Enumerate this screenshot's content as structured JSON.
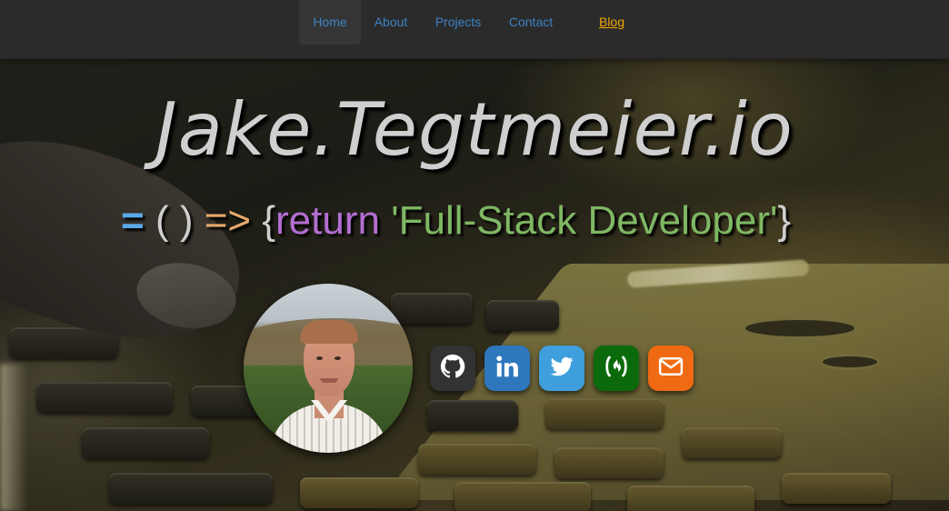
{
  "nav": {
    "items": [
      {
        "label": "Home",
        "active": true
      },
      {
        "label": "About",
        "active": false
      },
      {
        "label": "Projects",
        "active": false
      },
      {
        "label": "Contact",
        "active": false
      }
    ],
    "blog_label": "Blog",
    "colors": {
      "link": "#3d82c4",
      "blog": "#f0a500",
      "background": "#2b2b2b"
    }
  },
  "hero": {
    "title": "Jake.Tegtmeier.io",
    "tagline": {
      "equals": "=",
      "parens": "( )",
      "arrow": "=>",
      "open_brace": "{",
      "keyword": "return",
      "string": "'Full-Stack Developer'",
      "close_brace": "}"
    },
    "avatar_icon": "profile-photo"
  },
  "social": [
    {
      "name": "github",
      "icon": "github-icon",
      "color": "#333333"
    },
    {
      "name": "linkedin",
      "icon": "linkedin-icon",
      "color": "#2e77bd"
    },
    {
      "name": "twitter",
      "icon": "twitter-icon",
      "color": "#3f9fdc"
    },
    {
      "name": "freecodecamp",
      "icon": "freecodecamp-icon",
      "color": "#0b6a0b"
    },
    {
      "name": "email",
      "icon": "envelope-icon",
      "color": "#ef6a12"
    }
  ]
}
